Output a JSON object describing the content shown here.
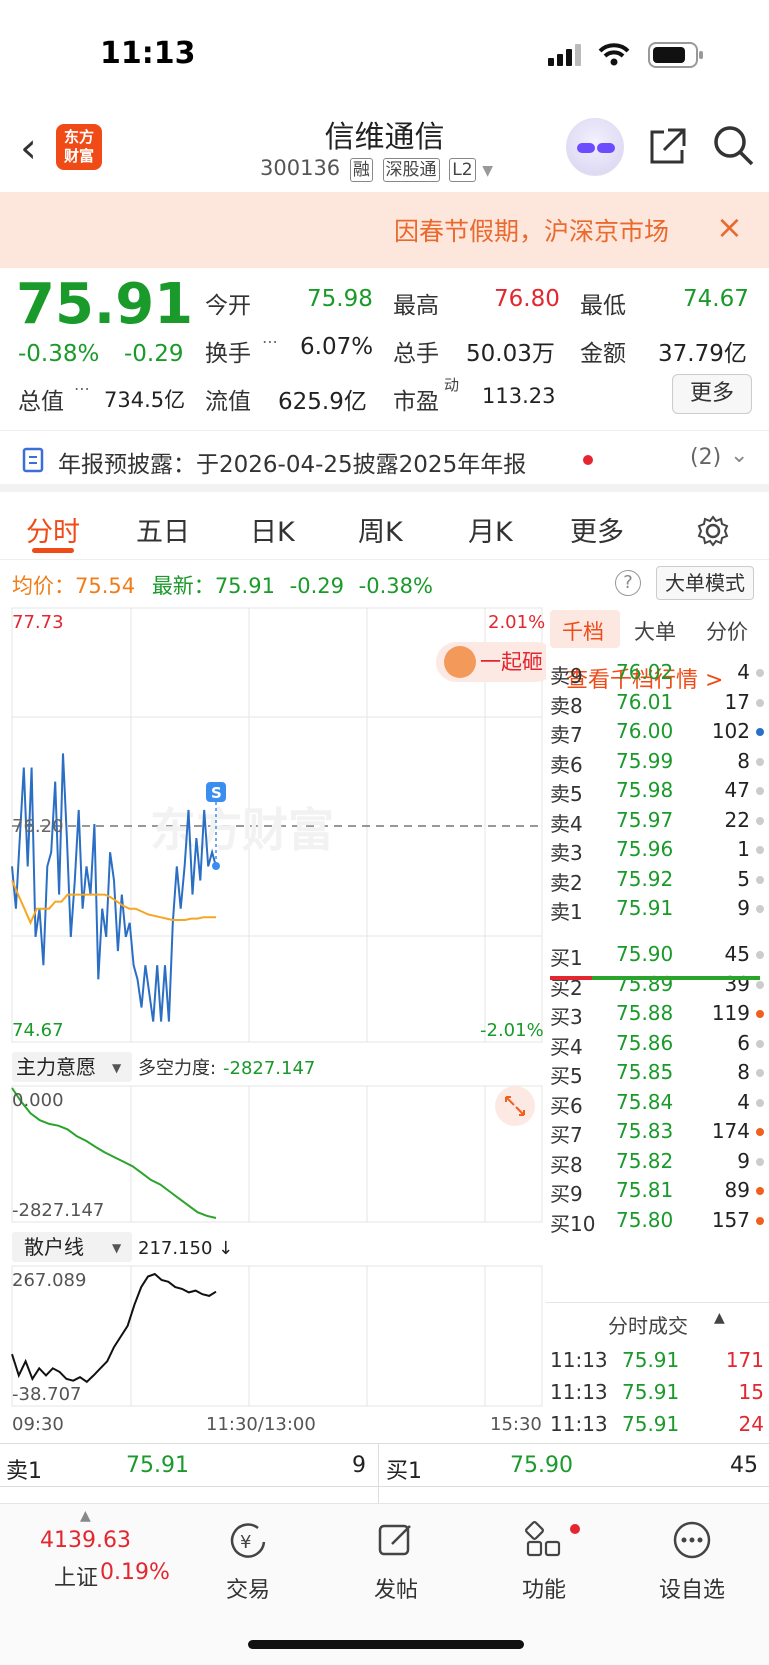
{
  "status_bar": {
    "time": "11:13"
  },
  "header": {
    "logo_text_line1": "东方",
    "logo_text_line2": "财富",
    "stock_name": "信维通信",
    "stock_code": "300136",
    "tags": [
      "融",
      "深股通",
      "L2"
    ]
  },
  "notice": {
    "text": "因春节假期，沪深京市场",
    "close": "×"
  },
  "quote": {
    "price": "75.91",
    "change_pct": "-0.38%",
    "change_amt": "-0.29",
    "open_label": "今开",
    "open": "75.98",
    "high_label": "最高",
    "high": "76.80",
    "low_label": "最低",
    "low": "74.67",
    "turnover_label": "换手",
    "turnover": "6.07%",
    "volume_label": "总手",
    "volume": "50.03万",
    "amount_label": "金额",
    "amount": "37.79亿",
    "mktcap_label": "总值",
    "mktcap": "734.5亿",
    "float_label": "流值",
    "float": "625.9亿",
    "pe_label": "市盈",
    "pe_sup": "动",
    "pe": "113.23",
    "more_button": "更多"
  },
  "announcement": {
    "text": "年报预披露：于2026-04-25披露2025年年报",
    "count": "(2)"
  },
  "tabs": [
    "分时",
    "五日",
    "日K",
    "周K",
    "月K",
    "更多"
  ],
  "info_line": {
    "avg_label": "均价：",
    "avg": "75.54",
    "last_label": "最新：",
    "last": "75.91",
    "chg": "-0.29",
    "pct": "-0.38%",
    "big_order_mode": "大单模式",
    "help": "?"
  },
  "chart_data": [
    {
      "type": "line",
      "title": "分时",
      "y_axis": {
        "top": "77.73",
        "bottom": "74.67",
        "ref": "76.20",
        "top_pct": "2.01%",
        "bottom_pct": "-2.01%"
      },
      "x_ticks": [
        "09:30",
        "11:30/13:00",
        "15:30"
      ],
      "ylim": [
        74.67,
        77.73
      ],
      "series": [
        {
          "color": "#2b6fc4",
          "values": [
            75.9,
            75.6,
            76.1,
            76.6,
            75.9,
            76.6,
            75.4,
            75.6,
            75.2,
            75.9,
            76.0,
            76.5,
            75.7,
            76.7,
            76.1,
            75.4,
            75.8,
            76.3,
            75.6,
            75.9,
            75.7,
            76.2,
            75.1,
            75.6,
            75.4,
            76.0,
            75.8,
            75.3,
            75.7,
            75.4,
            75.5,
            75.2,
            75.1,
            74.9,
            75.2,
            75.0,
            74.8,
            75.2,
            74.8,
            75.2,
            74.8,
            75.5,
            75.9,
            75.6,
            75.9,
            76.3,
            75.7,
            76.1,
            75.8,
            76.3,
            75.9,
            76.0,
            75.9
          ]
        },
        {
          "color": "#f5a623",
          "values": [
            75.8,
            75.7,
            75.6,
            75.5,
            75.6,
            75.6,
            75.6,
            75.65,
            75.65,
            75.7,
            75.7,
            75.7,
            75.7,
            75.7,
            75.7,
            75.7,
            75.68,
            75.65,
            75.62,
            75.6,
            75.6,
            75.58,
            75.56,
            75.55,
            75.54,
            75.53,
            75.52,
            75.52,
            75.52,
            75.53,
            75.53,
            75.54,
            75.54,
            75.54
          ]
        }
      ]
    },
    {
      "type": "line",
      "title": "主力意愿",
      "y_axis": {
        "top": "0.000",
        "bottom": "-2827.147"
      },
      "ylim": [
        -2827.147,
        0
      ],
      "series": [
        {
          "color": "#2aa42a",
          "values": [
            0,
            -300,
            -550,
            -700,
            -780,
            -820,
            -900,
            -1050,
            -1150,
            -1280,
            -1400,
            -1500,
            -1600,
            -1700,
            -1850,
            -2000,
            -2100,
            -2250,
            -2400,
            -2550,
            -2700,
            -2780,
            -2827
          ]
        }
      ]
    },
    {
      "type": "line",
      "title": "散户线",
      "y_axis": {
        "top": "267.089",
        "bottom": "-38.707"
      },
      "ylim": [
        -38.707,
        267.089
      ],
      "series": [
        {
          "color": "#111111",
          "values": [
            40,
            -20,
            20,
            -30,
            0,
            -20,
            0,
            -10,
            -30,
            -35,
            -25,
            -38,
            -20,
            0,
            20,
            60,
            90,
            120,
            180,
            230,
            260,
            267,
            250,
            245,
            230,
            225,
            215,
            220,
            210,
            205,
            217
          ]
        }
      ]
    }
  ],
  "indicator1": {
    "name": "主力意愿",
    "extra_label": "多空力度:",
    "extra_value": "-2827.147"
  },
  "indicator2": {
    "name": "散户线",
    "value": "217.150 ↓"
  },
  "promo": {
    "text": "一起砸"
  },
  "orderbook": {
    "tabs": [
      "千档",
      "大单",
      "分价"
    ],
    "link": "查看千档行情 >",
    "asks": [
      {
        "n": "卖9",
        "p": "76.02",
        "v": "4",
        "dot": "#ccc"
      },
      {
        "n": "卖8",
        "p": "76.01",
        "v": "17",
        "dot": "#ccc"
      },
      {
        "n": "卖7",
        "p": "76.00",
        "v": "102",
        "dot": "#2b6fc4"
      },
      {
        "n": "卖6",
        "p": "75.99",
        "v": "8",
        "dot": "#ccc"
      },
      {
        "n": "卖5",
        "p": "75.98",
        "v": "47",
        "dot": "#ccc"
      },
      {
        "n": "卖4",
        "p": "75.97",
        "v": "22",
        "dot": "#ccc"
      },
      {
        "n": "卖3",
        "p": "75.96",
        "v": "1",
        "dot": "#ccc"
      },
      {
        "n": "卖2",
        "p": "75.92",
        "v": "5",
        "dot": "#ccc"
      },
      {
        "n": "卖1",
        "p": "75.91",
        "v": "9",
        "dot": "#ccc"
      }
    ],
    "bids": [
      {
        "n": "买1",
        "p": "75.90",
        "v": "45",
        "dot": "#ccc"
      },
      {
        "n": "买2",
        "p": "75.89",
        "v": "39",
        "dot": "#ccc"
      },
      {
        "n": "买3",
        "p": "75.88",
        "v": "119",
        "dot": "#f0601c"
      },
      {
        "n": "买4",
        "p": "75.86",
        "v": "6",
        "dot": "#ccc"
      },
      {
        "n": "买5",
        "p": "75.85",
        "v": "8",
        "dot": "#ccc"
      },
      {
        "n": "买6",
        "p": "75.84",
        "v": "4",
        "dot": "#ccc"
      },
      {
        "n": "买7",
        "p": "75.83",
        "v": "174",
        "dot": "#f0601c"
      },
      {
        "n": "买8",
        "p": "75.82",
        "v": "9",
        "dot": "#ccc"
      },
      {
        "n": "买9",
        "p": "75.81",
        "v": "89",
        "dot": "#f0601c"
      },
      {
        "n": "买10",
        "p": "75.80",
        "v": "157",
        "dot": "#f0601c"
      }
    ],
    "trades_title": "分时成交",
    "trades": [
      {
        "t": "11:13",
        "p": "75.91",
        "v": "171"
      },
      {
        "t": "11:13",
        "p": "75.91",
        "v": "15"
      },
      {
        "t": "11:13",
        "p": "75.91",
        "v": "24"
      }
    ]
  },
  "quote_bar": {
    "ask_label": "卖1",
    "ask_price": "75.91",
    "ask_vol": "9",
    "bid_label": "买1",
    "bid_price": "75.90",
    "bid_vol": "45"
  },
  "bottom_nav": {
    "index_value": "4139.63",
    "index_name": "上证",
    "index_pct": "0.19%",
    "items": [
      "交易",
      "发帖",
      "功能",
      "设自选"
    ]
  }
}
